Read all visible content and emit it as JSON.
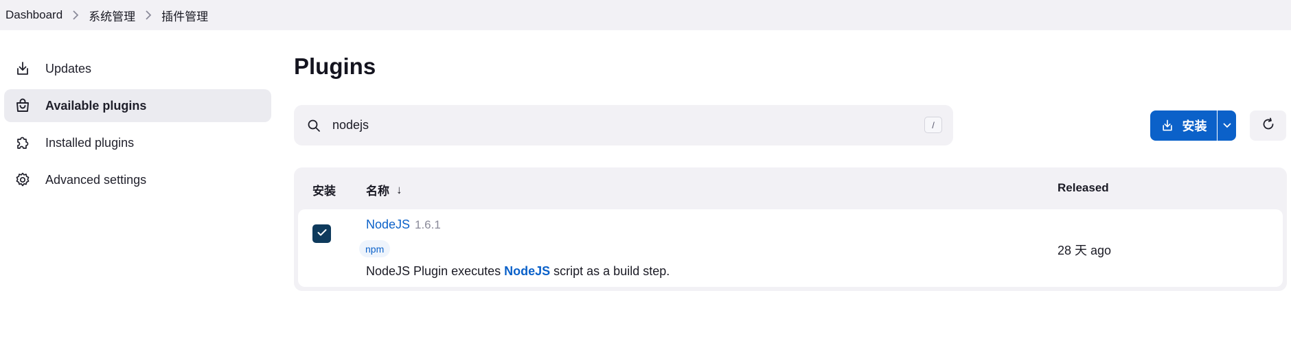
{
  "breadcrumb": [
    "Dashboard",
    "系统管理",
    "插件管理"
  ],
  "sidebar": {
    "items": [
      {
        "label": "Updates",
        "icon": "download-tray-icon",
        "active": false
      },
      {
        "label": "Available plugins",
        "icon": "shopping-bag-icon",
        "active": true
      },
      {
        "label": "Installed plugins",
        "icon": "puzzle-icon",
        "active": false
      },
      {
        "label": "Advanced settings",
        "icon": "gear-icon",
        "active": false
      }
    ]
  },
  "page": {
    "title": "Plugins"
  },
  "search": {
    "value": "nodejs",
    "shortcut": "/"
  },
  "toolbar": {
    "install_label": "安装"
  },
  "table": {
    "headers": {
      "install": "安装",
      "name": "名称",
      "sort_indicator": "↓",
      "released": "Released"
    },
    "rows": [
      {
        "checked": true,
        "name": "NodeJS",
        "version": "1.6.1",
        "tag": "npm",
        "description_before": "NodeJS Plugin executes ",
        "description_highlight": "NodeJS",
        "description_after": " script as a build step.",
        "released": "28 天 ago"
      }
    ]
  },
  "colors": {
    "accent": "#0b61c9",
    "checkbox": "#0e3a5c",
    "panel": "#f2f1f5"
  }
}
